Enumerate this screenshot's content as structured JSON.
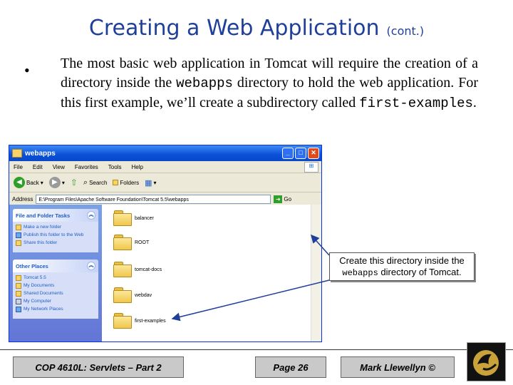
{
  "slide": {
    "title": "Creating a Web Application",
    "title_suffix": "(cont.)",
    "bullet": "•",
    "para": {
      "p1": "The most basic web application in Tomcat will require the creation of a directory inside the ",
      "code1": "webapps",
      "p2": " directory to hold the web application.  For this first example, we’ll create a subdirectory called ",
      "code2": "first-examples",
      "p3": "."
    }
  },
  "window": {
    "title": "webapps",
    "buttons": {
      "minimize": "_",
      "maximize": "□",
      "close": "✕"
    },
    "menus": [
      "File",
      "Edit",
      "View",
      "Favorites",
      "Tools",
      "Help"
    ],
    "toolbar": {
      "back": "Back",
      "search": "Search",
      "folders": "Folders"
    },
    "address_label": "Address",
    "address_value": "E:\\Program Files\\Apache Software Foundation\\Tomcat 5.5\\webapps",
    "go_label": "Go",
    "file_tasks": {
      "header": "File and Folder Tasks",
      "items": [
        "Make a new folder",
        "Publish this folder to the Web",
        "Share this folder"
      ]
    },
    "other_places": {
      "header": "Other Places",
      "items": [
        "Tomcat 5.5",
        "My Documents",
        "Shared Documents",
        "My Computer",
        "My Network Places"
      ]
    },
    "folders": [
      "balancer",
      "ROOT",
      "tomcat-docs",
      "webdav",
      "first-examples"
    ]
  },
  "callout": {
    "line1": "Create this directory inside the",
    "code": "webapps",
    "line2": " directory of Tomcat."
  },
  "footer": {
    "course": "COP 4610L: Servlets – Part 2",
    "page": "Page 26",
    "author": "Mark Llewellyn ©"
  },
  "colors": {
    "title": "#1f3f9a",
    "xp_titlebar": "#0a50d8",
    "taskpane": "#6375d6",
    "footer_box": "#c9c9c9"
  }
}
